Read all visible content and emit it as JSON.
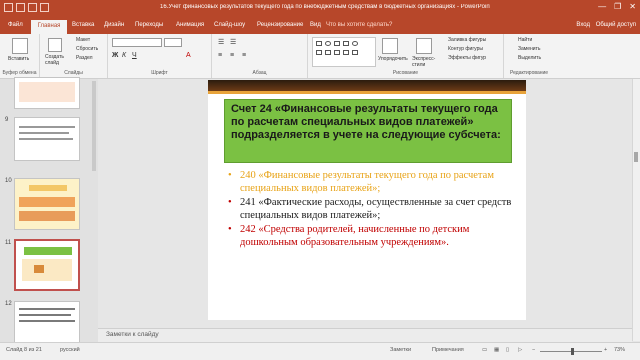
{
  "window": {
    "title": "16.Учет финансовых результатов текущего года по внебюджетным средствам в бюджетных организациях - PowerPoint",
    "buttons": [
      "—",
      "❐",
      "✕"
    ]
  },
  "ribbon_tabs": {
    "file": "Файл",
    "items": [
      "Главная",
      "Вставка",
      "Дизайн",
      "Переходы",
      "Анимация",
      "Слайд-шоу",
      "Рецензирование",
      "Вид"
    ],
    "tell_me": "Что вы хотите сделать?",
    "sign_in": "Вход",
    "share": "Общий доступ"
  },
  "ribbon": {
    "clipboard": {
      "label": "Буфер обмена",
      "paste": "Вставить"
    },
    "slides": {
      "label": "Слайды",
      "new_slide": "Создать слайд",
      "layout": "Макет",
      "reset": "Сбросить",
      "section": "Раздел"
    },
    "font": {
      "label": "Шрифт"
    },
    "paragraph": {
      "label": "Абзац"
    },
    "drawing": {
      "label": "Рисование",
      "arrange": "Упорядочить",
      "quick_styles": "Экспресс-стили",
      "fill": "Заливка фигуры",
      "outline": "Контур фигуры",
      "effects": "Эффекты фигур"
    },
    "editing": {
      "label": "Редактирование",
      "find": "Найти",
      "replace": "Заменить",
      "select": "Выделить"
    }
  },
  "thumbnails": [
    {
      "num": "",
      "selected": false
    },
    {
      "num": "9",
      "selected": false
    },
    {
      "num": "10",
      "selected": false
    },
    {
      "num": "11",
      "selected": true
    },
    {
      "num": "12",
      "selected": false
    }
  ],
  "slide": {
    "title": "Счет 24 «Финансовые результаты текущего года по расчетам специальных видов платежей» подразделяется в учете на следующие субсчета:",
    "bullets": [
      {
        "marker": "•",
        "text": "240 «Финансовые результаты текущего года по расчетам специальных видов платежей»;",
        "color": "#e8a317"
      },
      {
        "marker": "•",
        "text": "241 «Фактические расходы, осуществленные за счет средств специальных видов платежей»;",
        "color": "#1a1a1a"
      },
      {
        "marker": "•",
        "text": "242 «Средства родителей, начисленные по детским дошкольным образовательным учреждениям».",
        "color": "#c00000"
      }
    ]
  },
  "notes": {
    "placeholder": "Заметки к слайду"
  },
  "status": {
    "slide_info": "Слайд 8 из 21",
    "language": "русский",
    "notes": "Заметки",
    "comments": "Примечания",
    "zoom": "73%"
  },
  "colors": {
    "accent": "#b7472a",
    "title_box": "#7bc143"
  }
}
